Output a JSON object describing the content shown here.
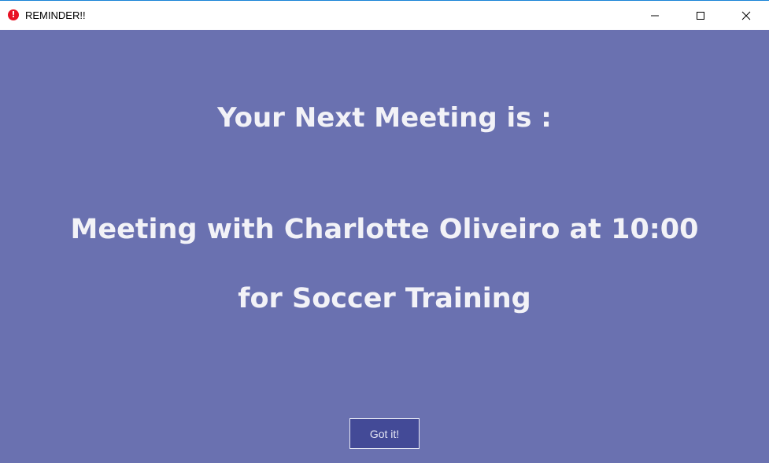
{
  "window": {
    "title": "REMINDER!!",
    "icon": "alert-icon",
    "icon_glyph": "!",
    "accent_color": "#e81123",
    "background_color": "#6a71b0"
  },
  "content": {
    "heading": "Your Next Meeting is :",
    "meeting_text": "Meeting with Charlotte Oliveiro at 10:00 for Soccer Training"
  },
  "actions": {
    "got_it_label": "Got it!",
    "button_color": "#434a97"
  }
}
